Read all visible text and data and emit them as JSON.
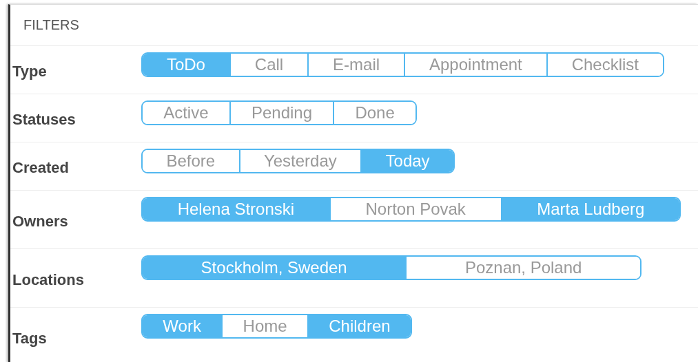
{
  "header": {
    "title": "FILTERS"
  },
  "filters": [
    {
      "label": "Type",
      "options": [
        {
          "label": "ToDo",
          "selected": true
        },
        {
          "label": "Call",
          "selected": false
        },
        {
          "label": "E-mail",
          "selected": false
        },
        {
          "label": "Appointment",
          "selected": false
        },
        {
          "label": "Checklist",
          "selected": false
        }
      ]
    },
    {
      "label": "Statuses",
      "options": [
        {
          "label": "Active",
          "selected": false
        },
        {
          "label": "Pending",
          "selected": false
        },
        {
          "label": "Done",
          "selected": false
        }
      ]
    },
    {
      "label": "Created",
      "options": [
        {
          "label": "Before",
          "selected": false
        },
        {
          "label": "Yesterday",
          "selected": false
        },
        {
          "label": "Today",
          "selected": true
        }
      ]
    },
    {
      "label": "Owners",
      "options": [
        {
          "label": "Helena Stronski",
          "selected": true
        },
        {
          "label": "Norton Povak",
          "selected": false
        },
        {
          "label": "Marta Ludberg",
          "selected": true
        }
      ]
    },
    {
      "label": "Locations",
      "options": [
        {
          "label": "Stockholm, Sweden",
          "selected": true
        },
        {
          "label": "Poznan, Poland",
          "selected": false
        }
      ]
    },
    {
      "label": "Tags",
      "options": [
        {
          "label": "Work",
          "selected": true
        },
        {
          "label": "Home",
          "selected": false
        },
        {
          "label": "Children",
          "selected": true
        }
      ]
    }
  ]
}
